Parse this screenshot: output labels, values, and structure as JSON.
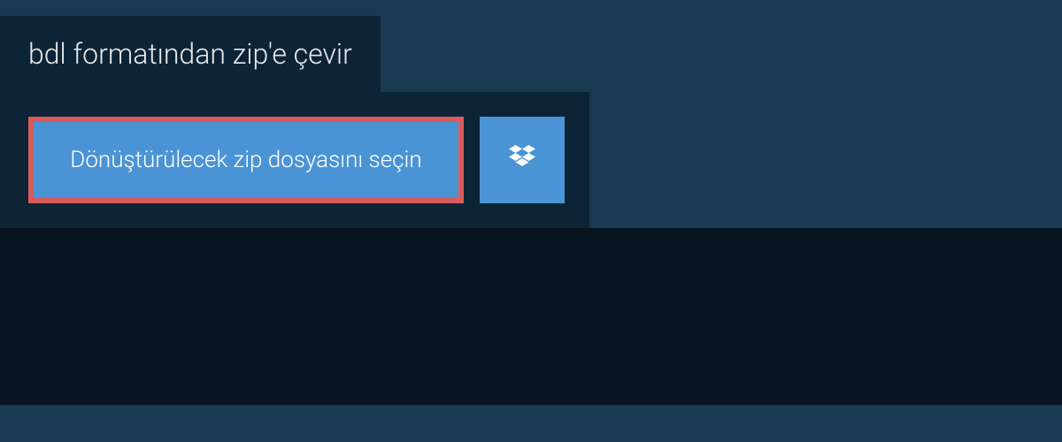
{
  "tab": {
    "title": "bdl formatından zip'e çevir"
  },
  "panel": {
    "select_label": "Dönüştürülecek zip dosyasını seçin"
  },
  "colors": {
    "page_bg": "#1a3a52",
    "panel_bg": "#0d2436",
    "button_bg": "#4a94d6",
    "highlight_border": "#d95b5b",
    "bottom_bg": "#08141f"
  }
}
